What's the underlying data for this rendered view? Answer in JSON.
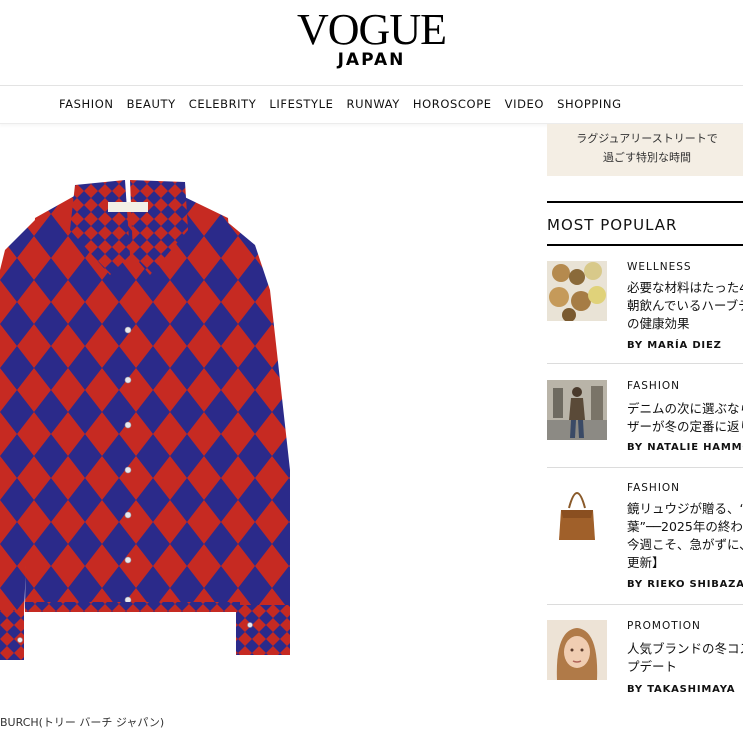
{
  "header": {
    "logo": "VOGUE",
    "logo_sub": "JAPAN"
  },
  "nav": {
    "items": [
      "FASHION",
      "BEAUTY",
      "CELEBRITY",
      "LIFESTYLE",
      "RUNWAY",
      "HOROSCOPE",
      "VIDEO",
      "SHOPPING"
    ]
  },
  "product": {
    "caption": "BURCH(トリー バーチ ジャパン)",
    "colors": {
      "red": "#c62a22",
      "blue": "#2b2a8a"
    }
  },
  "ad": {
    "line1": "ラグジュアリーストリートで",
    "line2": "過ごす特別な時間",
    "bg": "#f4eee4"
  },
  "most_popular": {
    "title": "MOST POPULAR",
    "articles": [
      {
        "category": "WELLNESS",
        "headline": [
          "必要な材料はたった4",
          "朝飲んでいるハーブテ",
          "の健康効果"
        ],
        "byline": "BY MARÍA DIEZ"
      },
      {
        "category": "FASHION",
        "headline": [
          "デニムの次に選ぶなら",
          "ザーが冬の定番に返り"
        ],
        "byline": "BY NATALIE HAMMO"
      },
      {
        "category": "FASHION",
        "headline": [
          "鏡リュウジが贈る、“福",
          "葉”──2025年の終わ",
          "今週こそ、急がずに、焦",
          "更新】"
        ],
        "byline": "BY RIEKO SHIBAZAK"
      },
      {
        "category": "PROMOTION",
        "headline": [
          "人気ブランドの冬コス",
          "プデート"
        ],
        "byline": "BY TAKASHIMAYA"
      }
    ]
  }
}
